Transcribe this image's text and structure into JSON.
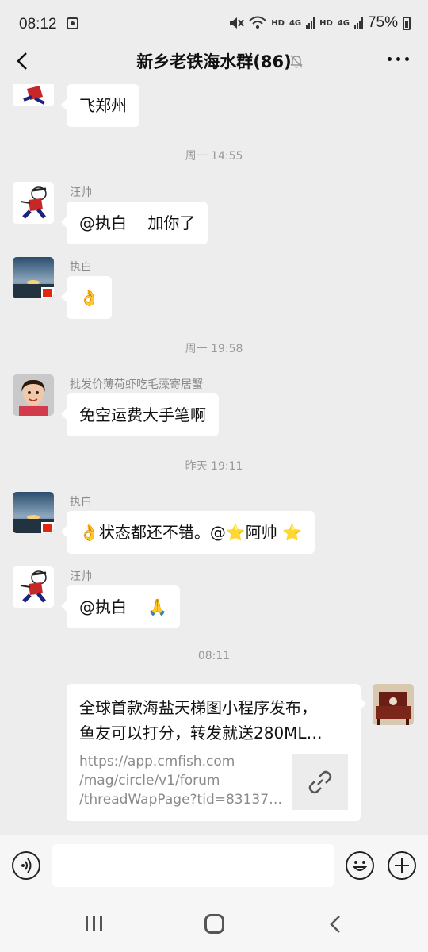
{
  "status_bar": {
    "time": "08:12",
    "hd_label_1": "HD",
    "net_label_1": "4G",
    "hd_label_2": "HD",
    "net_label_2": "4G",
    "battery": "75%"
  },
  "header": {
    "title": "新乡老铁海水群(86)"
  },
  "messages": [
    {
      "type": "in",
      "sender": "",
      "text": "飞郑州"
    },
    {
      "type": "time",
      "text": "周一 14:55"
    },
    {
      "type": "in",
      "sender": "汪帅",
      "text": "@执白　 加你了"
    },
    {
      "type": "in",
      "sender": "执白",
      "text": "👌"
    },
    {
      "type": "time",
      "text": "周一 19:58"
    },
    {
      "type": "in",
      "sender": "批发价薄荷虾吃毛藻寄居蟹",
      "text": "免空运费大手笔啊"
    },
    {
      "type": "time",
      "text": "昨天 19:11"
    },
    {
      "type": "in",
      "sender": "执白",
      "text": "👌状态都还不错。@⭐阿帅 ⭐"
    },
    {
      "type": "in",
      "sender": "汪帅",
      "text": "@执白　 🙏"
    },
    {
      "type": "time",
      "text": "08:11"
    }
  ],
  "link_card": {
    "title_line_1": "全球首款海盐天梯图小程序发布，",
    "title_line_2": "鱼友可以打分，转发就送280ML…",
    "url_line_1": "https://app.cmfish.com",
    "url_line_2": "/mag/circle/v1/forum",
    "url_line_3": "/threadWapPage?tid=83137…"
  },
  "input_bar": {
    "placeholder": ""
  },
  "icons": {
    "back": "chevron-left-icon",
    "mute": "bell-off-icon",
    "more": "more-horizontal-icon",
    "voice": "voice-icon",
    "emoji": "emoji-icon",
    "plus": "plus-icon",
    "link": "link-icon"
  },
  "colors": {
    "background": "#ededed",
    "bubble_in": "#ffffff",
    "timestamp": "#9a9a9a"
  }
}
